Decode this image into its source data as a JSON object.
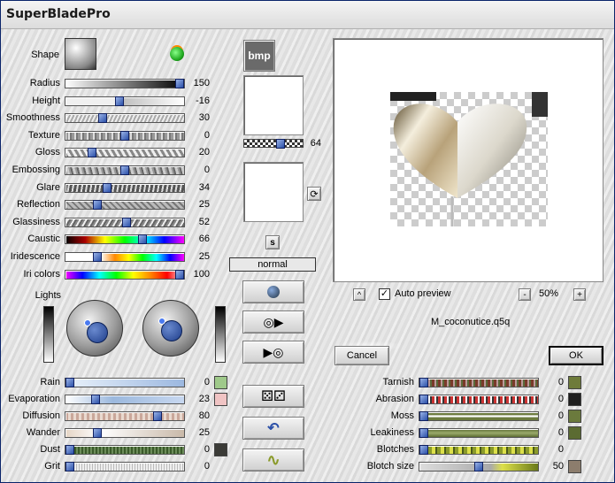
{
  "title": "SuperBladePro",
  "left_labels": {
    "shape": "Shape",
    "lights": "Lights"
  },
  "sliders": [
    {
      "label": "Radius",
      "value": "150",
      "fill": 1.0,
      "bg": "linear-gradient(90deg,#fff,#000)"
    },
    {
      "label": "Height",
      "value": "-16",
      "fill": 0.45,
      "bg": "linear-gradient(90deg,#f0f0f0 0 45%,#bbb 45%,#fff)"
    },
    {
      "label": "Smoothness",
      "value": "30",
      "fill": 0.3,
      "bg": "repeating-linear-gradient(115deg,#aaa 0 2px,#eee 2px 4px)"
    },
    {
      "label": "Texture",
      "value": "0",
      "fill": 0.5,
      "bg": "repeating-linear-gradient(90deg,#999 0 3px,#ddd 3px 5px,#777 5px 7px)"
    },
    {
      "label": "Gloss",
      "value": "20",
      "fill": 0.2,
      "bg": "repeating-linear-gradient(60deg,#888 0 3px,#eee 3px 6px)"
    },
    {
      "label": "Embossing",
      "value": "0",
      "fill": 0.5,
      "bg": "repeating-linear-gradient(75deg,#666 0 2px,#ccc 2px 5px,#999 5px 7px)"
    },
    {
      "label": "Glare",
      "value": "34",
      "fill": 0.34,
      "bg": "repeating-linear-gradient(100deg,#555 0 3px,#ddd 3px 5px)"
    },
    {
      "label": "Reflection",
      "value": "25",
      "fill": 0.25,
      "bg": "repeating-linear-gradient(45deg,#777 0 2px,#bbb 2px 5px)"
    },
    {
      "label": "Glassiness",
      "value": "52",
      "fill": 0.52,
      "bg": "repeating-linear-gradient(120deg,#888 0 2px,#eee 2px 4px,#666 4px 6px)"
    },
    {
      "label": "Caustic",
      "value": "66",
      "fill": 0.66,
      "bg": "linear-gradient(90deg,#000,#a00,#ff0,#0f0,#0ff,#00f,#f0f)"
    },
    {
      "label": "Iridescence",
      "value": "25",
      "fill": 0.25,
      "bg": "linear-gradient(90deg,#fff 0 30%,#f80,#ff0,#0f0,#0ff,#00f,#f0f)"
    },
    {
      "label": "Iri colors",
      "value": "100",
      "fill": 1.0,
      "bg": "linear-gradient(90deg,#f0f,#00f,#0ff,#0f0,#ff0,#f80,#f00,#fff)"
    }
  ],
  "bottom_left_sliders": [
    {
      "label": "Rain",
      "value": "0",
      "fill": 0.0,
      "swatch": "#9fc98a",
      "bg": "linear-gradient(90deg,#eaf2fb,#9cb8e0)"
    },
    {
      "label": "Evaporation",
      "value": "23",
      "fill": 0.23,
      "swatch": "#f0c4c4",
      "bg": "linear-gradient(90deg,#fff,#9bb8dd 40%,#c8d8f0)"
    },
    {
      "label": "Diffusion",
      "value": "80",
      "fill": 0.8,
      "swatch": "",
      "bg": "repeating-linear-gradient(90deg,#c9a79a 0 3px,#e9d9cf 3px 6px)"
    },
    {
      "label": "Wander",
      "value": "25",
      "fill": 0.25,
      "swatch": "",
      "bg": "linear-gradient(90deg,#e5d5c5,#fff 30%,#c9b9a9)"
    },
    {
      "label": "Dust",
      "value": "0",
      "fill": 0.0,
      "swatch": "#3b3b37",
      "bg": "repeating-linear-gradient(90deg,#6c8c5a 0 2px,#3a5a2a 2px 4px)"
    },
    {
      "label": "Grit",
      "value": "0",
      "fill": 0.0,
      "swatch": "",
      "bg": "repeating-linear-gradient(90deg,#bbb 0 1px,#eee 1px 3px)"
    }
  ],
  "bottom_right_sliders": [
    {
      "label": "Tarnish",
      "value": "0",
      "fill": 0.0,
      "swatch": "#6e7b3a",
      "bg": "repeating-linear-gradient(90deg,#7a3a2a 0 3px,#b99 3px 5px,#5a6a3a 5px 7px)"
    },
    {
      "label": "Abrasion",
      "value": "0",
      "fill": 0.0,
      "swatch": "#1e1e1e",
      "bg": "repeating-linear-gradient(90deg,#c33 0 3px,#fff 3px 5px,#333 5px 7px)"
    },
    {
      "label": "Moss",
      "value": "0",
      "fill": 0.0,
      "swatch": "#6b7a3d",
      "bg": "linear-gradient(#6b7a3d 0 30%,#fff 45% 55%,#6b7a3d 70%)"
    },
    {
      "label": "Leakiness",
      "value": "0",
      "fill": 0.0,
      "swatch": "#5b6b32",
      "bg": "linear-gradient(#5b6b32,#9aaa6a,#5b6b32)"
    },
    {
      "label": "Blotches",
      "value": "0",
      "fill": 0.0,
      "swatch": "",
      "bg": "repeating-linear-gradient(90deg,#8a9a2a 0 4px,#dde04a 4px 8px,#4a5a1a 8px 10px)"
    },
    {
      "label": "Blotch size",
      "value": "50",
      "fill": 0.5,
      "swatch": "#8c7d6d",
      "bg": "linear-gradient(90deg,#ddd,#aaa 60%,#dde04a 70%,#6a7a1a)"
    }
  ],
  "middle": {
    "bmp_label": "bmp",
    "tex_scale_value": "64",
    "blend_mode": "normal",
    "s_label": "s"
  },
  "preview": {
    "auto_preview_label": "Auto preview",
    "auto_preview_checked": true,
    "zoom": "50%",
    "minus": "-",
    "plus": "+",
    "up": "^",
    "preset_name": "M_coconutice.q5q"
  },
  "buttons": {
    "cancel": "Cancel",
    "ok": "OK"
  }
}
